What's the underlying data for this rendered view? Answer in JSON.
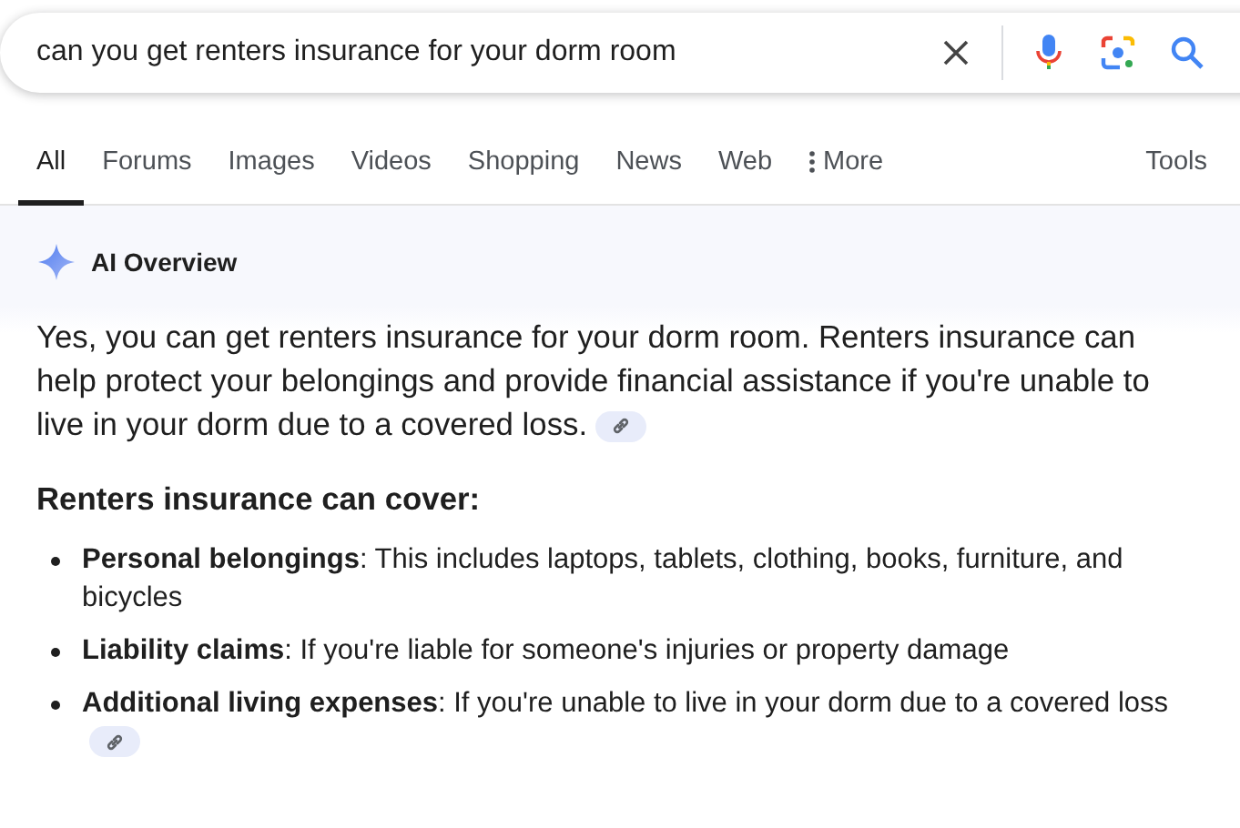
{
  "search": {
    "value": "can you get renters insurance for your dorm room"
  },
  "tabs": [
    {
      "label": "All",
      "selected": true
    },
    {
      "label": "Forums",
      "selected": false
    },
    {
      "label": "Images",
      "selected": false
    },
    {
      "label": "Videos",
      "selected": false
    },
    {
      "label": "Shopping",
      "selected": false
    },
    {
      "label": "News",
      "selected": false
    },
    {
      "label": "Web",
      "selected": false
    },
    {
      "label": "More",
      "selected": false,
      "kind": "menu"
    }
  ],
  "tools": "Tools",
  "overview": {
    "title": "AI Overview",
    "summary": {
      "text": "Yes, you can get renters insurance for your dorm room. Renters insurance can help protect your belongings and provide financial assistance if you're unable to live in your dorm due to a covered loss.",
      "has_link": true
    },
    "heading": "Renters insurance can cover:",
    "items": [
      {
        "text": "**Personal belongings**: This includes laptops, tablets, clothing, books, furniture, and bicycles",
        "has_link": false
      },
      {
        "text": "**Liability claims**: If you're liable for someone's injuries or property damage",
        "has_link": false
      },
      {
        "text": "**Additional living expenses**: If you're unable to live in your dorm due to a covered loss",
        "has_link": true
      }
    ]
  }
}
